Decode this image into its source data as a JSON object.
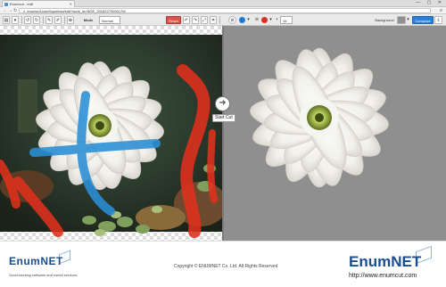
{
  "browser": {
    "tab_title": "Enumcut - edit",
    "url": "enumcut.com/fujuninso/edit?work_id=NGE_2016227000017M",
    "window_controls": "— ▢ ✕"
  },
  "toolbar": {
    "mode_label": "Mode",
    "mode_value": "Normal",
    "reset_label": "Reset",
    "brush_size": "15",
    "background_label": "Background",
    "compose_label": "Compose"
  },
  "canvas": {
    "start_label": "Start Cut",
    "panel_color": "#8f8f8f"
  },
  "footer": {
    "logo_left": "EnumNET",
    "tagline_left": "Good-working software and useful services",
    "copyright": "Copyright © ENUMNET Co. Ltd. All Rights Reserved",
    "logo_right": "EnumNET",
    "url_right": "http://www.enumcut.com"
  },
  "colors": {
    "accent": "#2b7fd7",
    "reset": "#d9534f",
    "brand": "#1a4d8f"
  }
}
